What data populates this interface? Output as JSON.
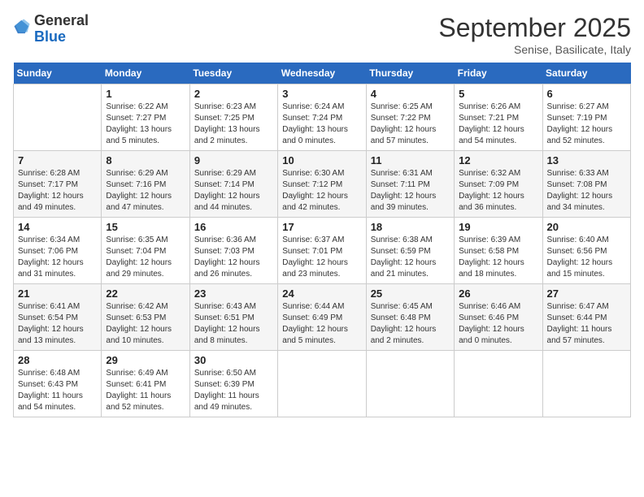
{
  "header": {
    "logo_general": "General",
    "logo_blue": "Blue",
    "month_title": "September 2025",
    "subtitle": "Senise, Basilicate, Italy"
  },
  "days_of_week": [
    "Sunday",
    "Monday",
    "Tuesday",
    "Wednesday",
    "Thursday",
    "Friday",
    "Saturday"
  ],
  "weeks": [
    [
      {
        "day": "",
        "sunrise": "",
        "sunset": "",
        "daylight": ""
      },
      {
        "day": "1",
        "sunrise": "Sunrise: 6:22 AM",
        "sunset": "Sunset: 7:27 PM",
        "daylight": "Daylight: 13 hours and 5 minutes."
      },
      {
        "day": "2",
        "sunrise": "Sunrise: 6:23 AM",
        "sunset": "Sunset: 7:25 PM",
        "daylight": "Daylight: 13 hours and 2 minutes."
      },
      {
        "day": "3",
        "sunrise": "Sunrise: 6:24 AM",
        "sunset": "Sunset: 7:24 PM",
        "daylight": "Daylight: 13 hours and 0 minutes."
      },
      {
        "day": "4",
        "sunrise": "Sunrise: 6:25 AM",
        "sunset": "Sunset: 7:22 PM",
        "daylight": "Daylight: 12 hours and 57 minutes."
      },
      {
        "day": "5",
        "sunrise": "Sunrise: 6:26 AM",
        "sunset": "Sunset: 7:21 PM",
        "daylight": "Daylight: 12 hours and 54 minutes."
      },
      {
        "day": "6",
        "sunrise": "Sunrise: 6:27 AM",
        "sunset": "Sunset: 7:19 PM",
        "daylight": "Daylight: 12 hours and 52 minutes."
      }
    ],
    [
      {
        "day": "7",
        "sunrise": "Sunrise: 6:28 AM",
        "sunset": "Sunset: 7:17 PM",
        "daylight": "Daylight: 12 hours and 49 minutes."
      },
      {
        "day": "8",
        "sunrise": "Sunrise: 6:29 AM",
        "sunset": "Sunset: 7:16 PM",
        "daylight": "Daylight: 12 hours and 47 minutes."
      },
      {
        "day": "9",
        "sunrise": "Sunrise: 6:29 AM",
        "sunset": "Sunset: 7:14 PM",
        "daylight": "Daylight: 12 hours and 44 minutes."
      },
      {
        "day": "10",
        "sunrise": "Sunrise: 6:30 AM",
        "sunset": "Sunset: 7:12 PM",
        "daylight": "Daylight: 12 hours and 42 minutes."
      },
      {
        "day": "11",
        "sunrise": "Sunrise: 6:31 AM",
        "sunset": "Sunset: 7:11 PM",
        "daylight": "Daylight: 12 hours and 39 minutes."
      },
      {
        "day": "12",
        "sunrise": "Sunrise: 6:32 AM",
        "sunset": "Sunset: 7:09 PM",
        "daylight": "Daylight: 12 hours and 36 minutes."
      },
      {
        "day": "13",
        "sunrise": "Sunrise: 6:33 AM",
        "sunset": "Sunset: 7:08 PM",
        "daylight": "Daylight: 12 hours and 34 minutes."
      }
    ],
    [
      {
        "day": "14",
        "sunrise": "Sunrise: 6:34 AM",
        "sunset": "Sunset: 7:06 PM",
        "daylight": "Daylight: 12 hours and 31 minutes."
      },
      {
        "day": "15",
        "sunrise": "Sunrise: 6:35 AM",
        "sunset": "Sunset: 7:04 PM",
        "daylight": "Daylight: 12 hours and 29 minutes."
      },
      {
        "day": "16",
        "sunrise": "Sunrise: 6:36 AM",
        "sunset": "Sunset: 7:03 PM",
        "daylight": "Daylight: 12 hours and 26 minutes."
      },
      {
        "day": "17",
        "sunrise": "Sunrise: 6:37 AM",
        "sunset": "Sunset: 7:01 PM",
        "daylight": "Daylight: 12 hours and 23 minutes."
      },
      {
        "day": "18",
        "sunrise": "Sunrise: 6:38 AM",
        "sunset": "Sunset: 6:59 PM",
        "daylight": "Daylight: 12 hours and 21 minutes."
      },
      {
        "day": "19",
        "sunrise": "Sunrise: 6:39 AM",
        "sunset": "Sunset: 6:58 PM",
        "daylight": "Daylight: 12 hours and 18 minutes."
      },
      {
        "day": "20",
        "sunrise": "Sunrise: 6:40 AM",
        "sunset": "Sunset: 6:56 PM",
        "daylight": "Daylight: 12 hours and 15 minutes."
      }
    ],
    [
      {
        "day": "21",
        "sunrise": "Sunrise: 6:41 AM",
        "sunset": "Sunset: 6:54 PM",
        "daylight": "Daylight: 12 hours and 13 minutes."
      },
      {
        "day": "22",
        "sunrise": "Sunrise: 6:42 AM",
        "sunset": "Sunset: 6:53 PM",
        "daylight": "Daylight: 12 hours and 10 minutes."
      },
      {
        "day": "23",
        "sunrise": "Sunrise: 6:43 AM",
        "sunset": "Sunset: 6:51 PM",
        "daylight": "Daylight: 12 hours and 8 minutes."
      },
      {
        "day": "24",
        "sunrise": "Sunrise: 6:44 AM",
        "sunset": "Sunset: 6:49 PM",
        "daylight": "Daylight: 12 hours and 5 minutes."
      },
      {
        "day": "25",
        "sunrise": "Sunrise: 6:45 AM",
        "sunset": "Sunset: 6:48 PM",
        "daylight": "Daylight: 12 hours and 2 minutes."
      },
      {
        "day": "26",
        "sunrise": "Sunrise: 6:46 AM",
        "sunset": "Sunset: 6:46 PM",
        "daylight": "Daylight: 12 hours and 0 minutes."
      },
      {
        "day": "27",
        "sunrise": "Sunrise: 6:47 AM",
        "sunset": "Sunset: 6:44 PM",
        "daylight": "Daylight: 11 hours and 57 minutes."
      }
    ],
    [
      {
        "day": "28",
        "sunrise": "Sunrise: 6:48 AM",
        "sunset": "Sunset: 6:43 PM",
        "daylight": "Daylight: 11 hours and 54 minutes."
      },
      {
        "day": "29",
        "sunrise": "Sunrise: 6:49 AM",
        "sunset": "Sunset: 6:41 PM",
        "daylight": "Daylight: 11 hours and 52 minutes."
      },
      {
        "day": "30",
        "sunrise": "Sunrise: 6:50 AM",
        "sunset": "Sunset: 6:39 PM",
        "daylight": "Daylight: 11 hours and 49 minutes."
      },
      {
        "day": "",
        "sunrise": "",
        "sunset": "",
        "daylight": ""
      },
      {
        "day": "",
        "sunrise": "",
        "sunset": "",
        "daylight": ""
      },
      {
        "day": "",
        "sunrise": "",
        "sunset": "",
        "daylight": ""
      },
      {
        "day": "",
        "sunrise": "",
        "sunset": "",
        "daylight": ""
      }
    ]
  ]
}
